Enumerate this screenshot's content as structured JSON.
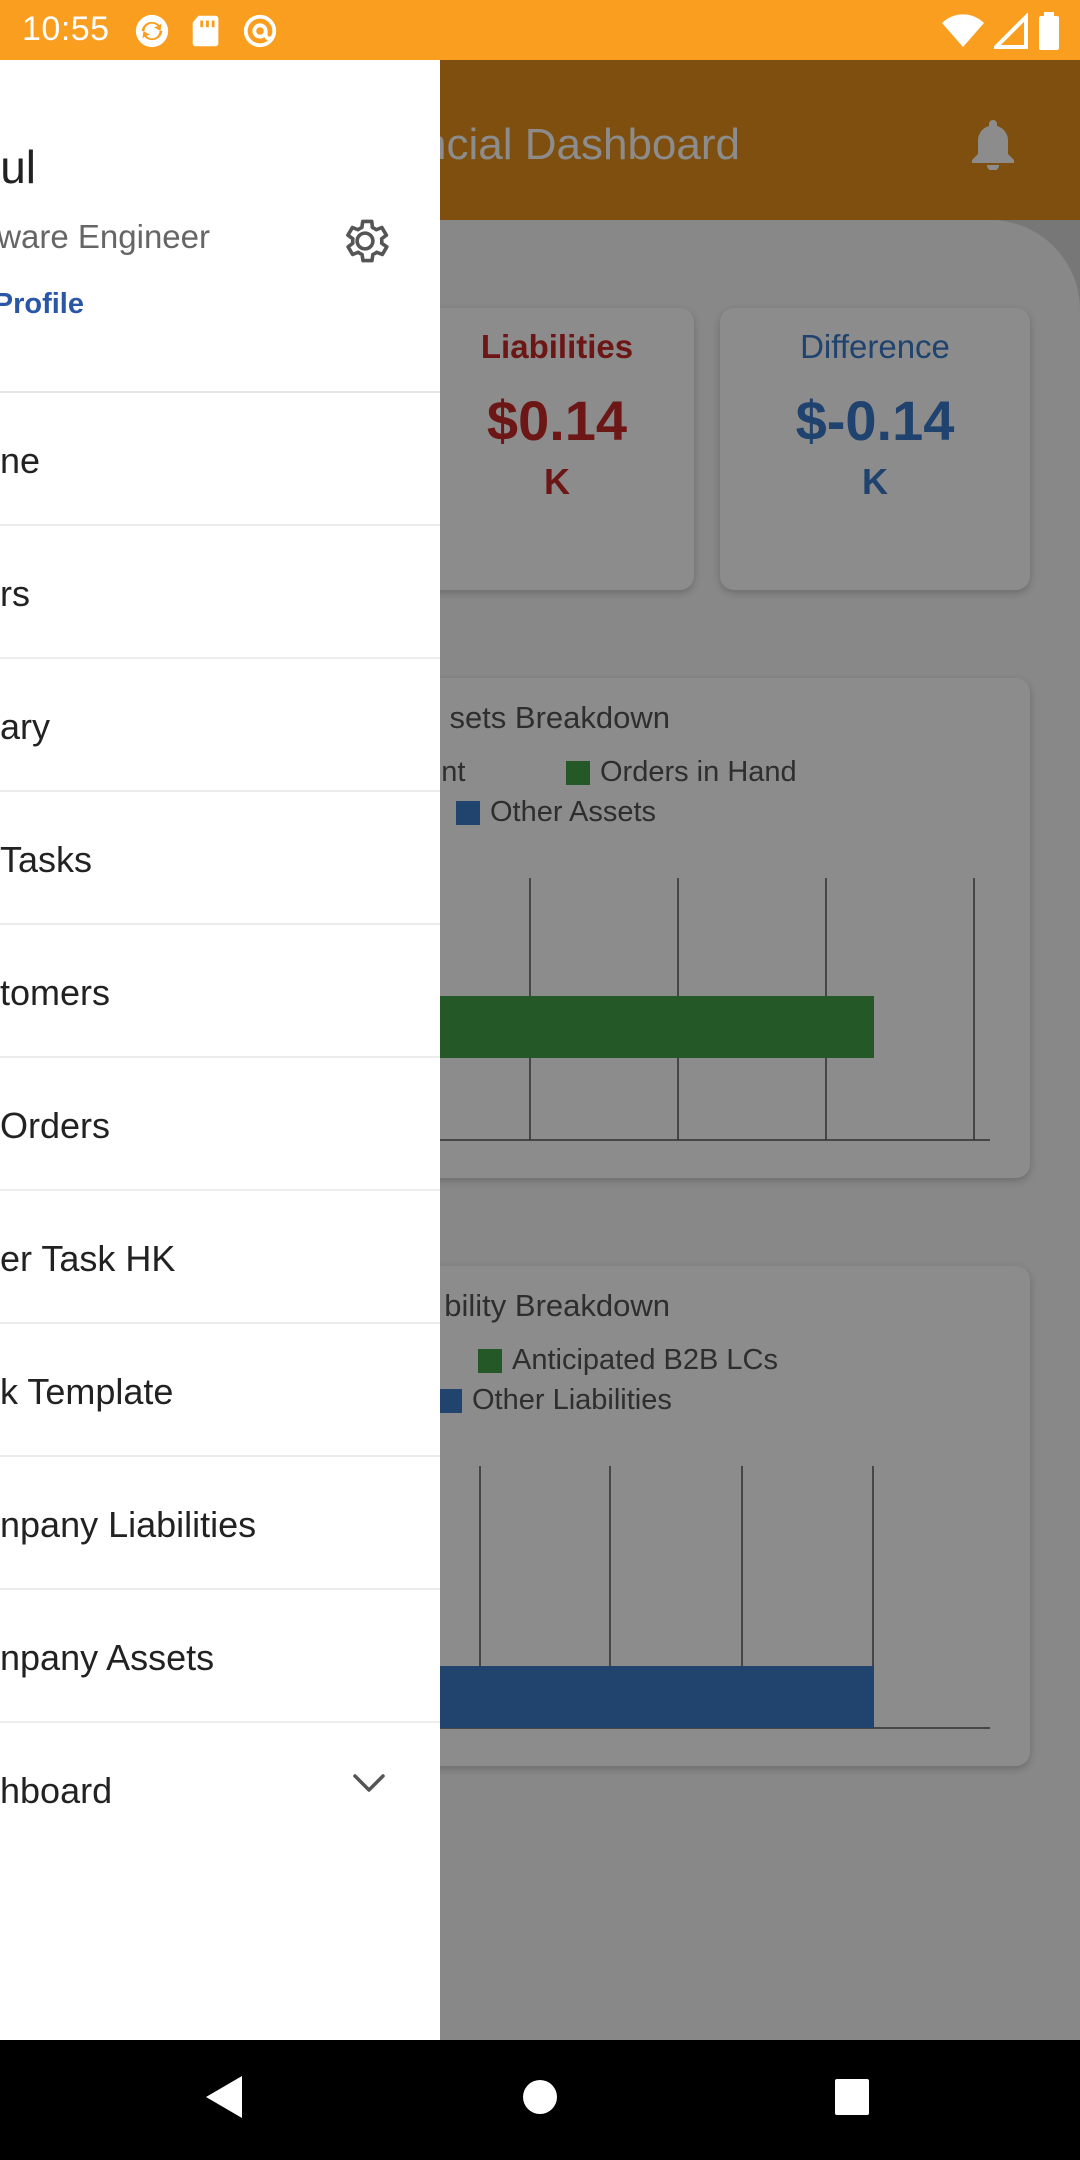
{
  "status_bar": {
    "time": "10:55",
    "left_icons": [
      "sync-icon",
      "sd-card-icon",
      "at-sign-icon"
    ],
    "right_icons": [
      "wifi-icon",
      "signal-icon",
      "battery-icon"
    ],
    "color": "#F99E1F"
  },
  "app": {
    "title": "ncial Dashboard",
    "header_color": "#E6911B",
    "liabilities": {
      "label": "Liabilities",
      "value": "$0.14",
      "unit": "K",
      "color": "#c62828"
    },
    "difference": {
      "label": "Difference",
      "value": "$-0.14",
      "unit": "K",
      "color": "#3a7bc8"
    },
    "assets_chart": {
      "title": "sets Breakdown",
      "legend": [
        "ccount",
        "Orders in Hand",
        "Other Assets"
      ]
    },
    "liability_chart": {
      "title": "bility Breakdown",
      "legend": [
        "Anticipated B2B LCs",
        "Other Liabilities"
      ]
    }
  },
  "chart_data": [
    {
      "type": "bar",
      "orientation": "horizontal",
      "title": "sets Breakdown",
      "series": [
        {
          "name": "ccount",
          "values": [
            0
          ]
        },
        {
          "name": "Orders in Hand",
          "values": [
            1
          ],
          "color": "#43A047"
        },
        {
          "name": "Other Assets",
          "values": [
            0
          ],
          "color": "#3d7cc9"
        }
      ],
      "grid": true
    },
    {
      "type": "bar",
      "orientation": "horizontal",
      "title": "bility Breakdown",
      "series": [
        {
          "name": "Anticipated B2B LCs",
          "values": [
            0
          ],
          "color": "#43A047"
        },
        {
          "name": "Other Liabilities",
          "values": [
            1
          ],
          "color": "#3d7cc9"
        }
      ],
      "grid": true
    }
  ],
  "drawer": {
    "user_name": "ul",
    "user_role": "ware Engineer",
    "profile_link": "Profile",
    "items": [
      {
        "label": "ne"
      },
      {
        "label": "rs"
      },
      {
        "label": "ary"
      },
      {
        "label": "Tasks"
      },
      {
        "label": "tomers"
      },
      {
        "label": "Orders"
      },
      {
        "label": "er Task HK"
      },
      {
        "label": "k Template"
      },
      {
        "label": "npany Liabilities"
      },
      {
        "label": "npany Assets"
      },
      {
        "label": "hboard",
        "icon": "chevron-down-icon"
      }
    ]
  },
  "nav_bar": {
    "buttons": [
      "back-icon",
      "home-icon",
      "recents-icon"
    ]
  }
}
